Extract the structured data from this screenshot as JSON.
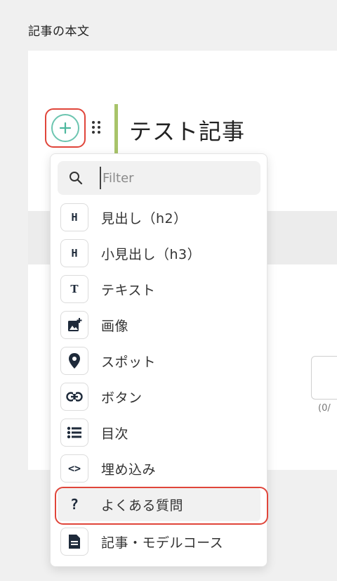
{
  "section": {
    "label": "記事の本文"
  },
  "editor": {
    "title": "テスト記事"
  },
  "side": {
    "count": "(0/"
  },
  "menu": {
    "filter_placeholder": "Filter",
    "items": [
      {
        "label": "見出し（h2）",
        "icon": "H",
        "icon_name": "heading-icon"
      },
      {
        "label": "小見出し（h3）",
        "icon": "H",
        "icon_name": "subheading-icon"
      },
      {
        "label": "テキスト",
        "icon": "T",
        "icon_name": "text-icon"
      },
      {
        "label": "画像",
        "icon": "",
        "icon_name": "image-add-icon"
      },
      {
        "label": "スポット",
        "icon": "",
        "icon_name": "map-pin-icon"
      },
      {
        "label": "ボタン",
        "icon": "",
        "icon_name": "link-icon"
      },
      {
        "label": "目次",
        "icon": "",
        "icon_name": "list-icon"
      },
      {
        "label": "埋め込み",
        "icon": "<>",
        "icon_name": "code-icon"
      },
      {
        "label": "よくある質問",
        "icon": "?",
        "icon_name": "question-icon"
      },
      {
        "label": "記事・モデルコース",
        "icon": "",
        "icon_name": "document-icon"
      }
    ]
  },
  "colors": {
    "accent_teal": "#6cc5b0",
    "highlight_red": "#e0453a",
    "title_bar": "#a8c46a"
  }
}
